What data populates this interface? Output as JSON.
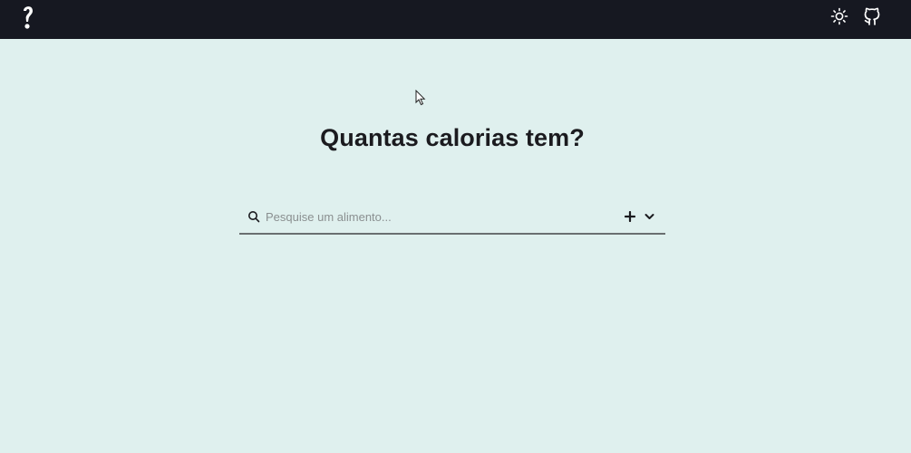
{
  "header": {
    "logo_icon": "question-mark-logo-icon",
    "theme_toggle_icon": "sun-icon",
    "repo_link_icon": "github-icon",
    "background": "#161821"
  },
  "main": {
    "title": "Quantas calorias tem?",
    "background": "#dff0ee"
  },
  "search": {
    "placeholder": "Pesquise um alimento...",
    "value": "",
    "leading_icon": "search-icon",
    "add_icon": "plus-icon",
    "expand_icon": "chevron-down-icon"
  }
}
